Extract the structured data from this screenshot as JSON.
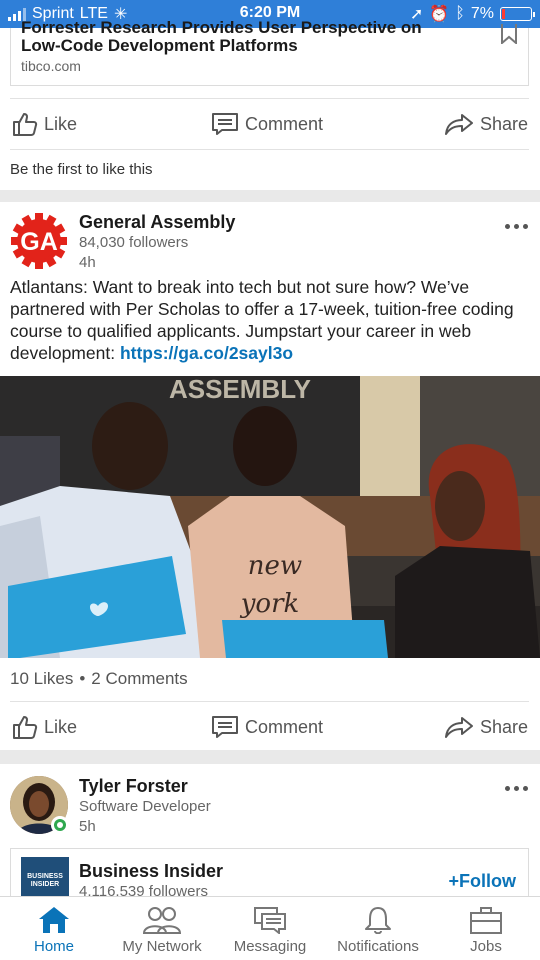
{
  "status": {
    "carrier": "Sprint",
    "network": "LTE",
    "time": "6:20 PM",
    "battery": "7%"
  },
  "card1": {
    "article_title_line1": "Forrester Research Provides User Perspective on",
    "article_title_line2": "Low-Code Development Platforms",
    "article_source": "tibco.com",
    "like_label": "Like",
    "comment_label": "Comment",
    "share_label": "Share",
    "first_like": "Be the first to like this"
  },
  "post": {
    "author": "General Assembly",
    "followers": "84,030 followers",
    "time": "4h",
    "text": "Atlantans: Want to break into tech but not sure how? We’ve partnered with Per Scholas to offer a 17-week, tuition-free coding course to qualified applicants. Jumpstart your career in web development: ",
    "link": "https://ga.co/2sayl3o",
    "photo_sign": "ASSEMBLY",
    "shirt_text_1": "new",
    "shirt_text_2": "york",
    "likes": "10 Likes",
    "comments": "2 Comments",
    "like_label": "Like",
    "comment_label": "Comment",
    "share_label": "Share"
  },
  "card3": {
    "name": "Tyler Forster",
    "title": "Software Developer",
    "time": "5h",
    "company": "Business Insider",
    "company_followers": "4,116,539 followers",
    "follow_label": "Follow",
    "logo_text": "BUSINESS INSIDER"
  },
  "nav": {
    "home": "Home",
    "network": "My Network",
    "messaging": "Messaging",
    "notifications": "Notifications",
    "jobs": "Jobs"
  },
  "colors": {
    "statusbar": "#2f7fd8",
    "link": "#0a73b8",
    "ga_red": "#e2231a"
  }
}
